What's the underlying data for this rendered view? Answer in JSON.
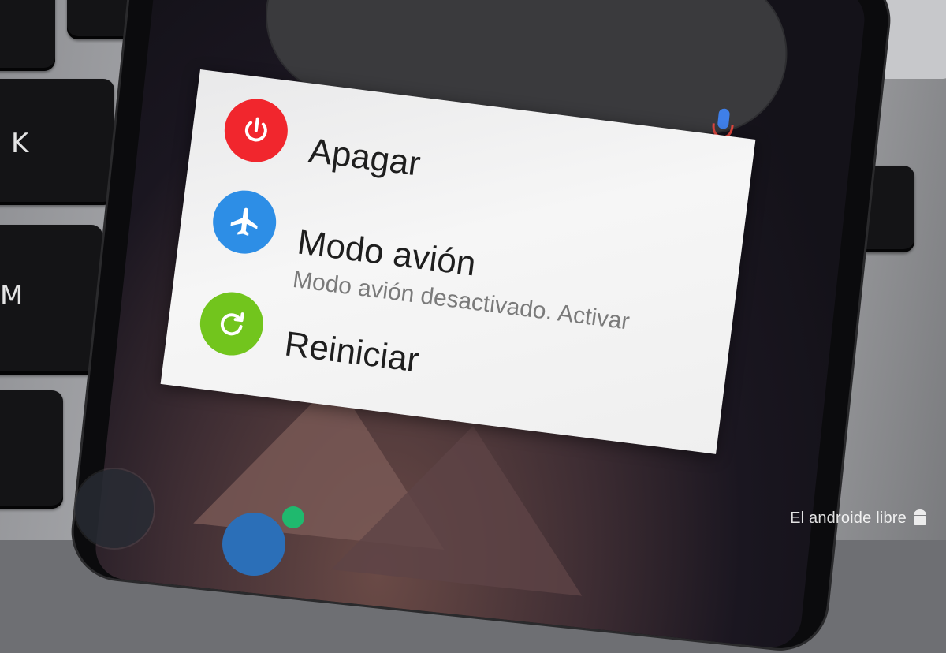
{
  "keyboard": {
    "keys": [
      "K",
      "M"
    ]
  },
  "power_menu": {
    "items": [
      {
        "label": "Apagar",
        "sublabel": "",
        "icon": "power-icon",
        "color": "#f1262d"
      },
      {
        "label": "Modo avión",
        "sublabel": "Modo avión desactivado. Activar",
        "icon": "airplane-icon",
        "color": "#2d8ee6"
      },
      {
        "label": "Reiniciar",
        "sublabel": "",
        "icon": "restart-icon",
        "color": "#72c51d"
      }
    ]
  },
  "watermark": "El androide libre"
}
